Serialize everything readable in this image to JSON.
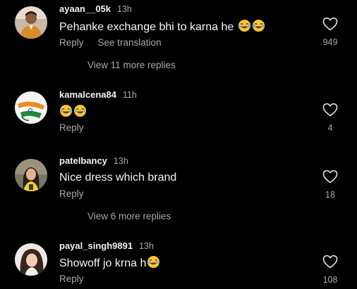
{
  "comments": [
    {
      "username": "ayaan__05k",
      "time": "13h",
      "text": "Pehanke exchange bhi to karna he",
      "emoji": [
        "laughing-face-emoji",
        "laughing-face-emoji"
      ],
      "reply_label": "Reply",
      "see_translation_label": "See translation",
      "likes": "949",
      "view_replies": "View 11 more replies"
    },
    {
      "username": "kamalcena84",
      "time": "11h",
      "text": "",
      "emoji": [
        "laughing-face-emoji",
        "laughing-face-emoji"
      ],
      "reply_label": "Reply",
      "likes": "4"
    },
    {
      "username": "patelbancy",
      "time": "13h",
      "text": "Nice dress which brand",
      "reply_label": "Reply",
      "likes": "18",
      "view_replies": "View 6 more replies"
    },
    {
      "username": "payal_singh9891",
      "time": "13h",
      "text": "Showoff jo krna h",
      "emoji": [
        "laughing-face-emoji"
      ],
      "reply_label": "Reply",
      "likes": "108"
    }
  ],
  "icons": {
    "like": "heart-outline-icon"
  },
  "colors": {
    "background": "#000000",
    "primary_text": "#f5f5f5",
    "secondary_text": "#a8a8a8"
  }
}
